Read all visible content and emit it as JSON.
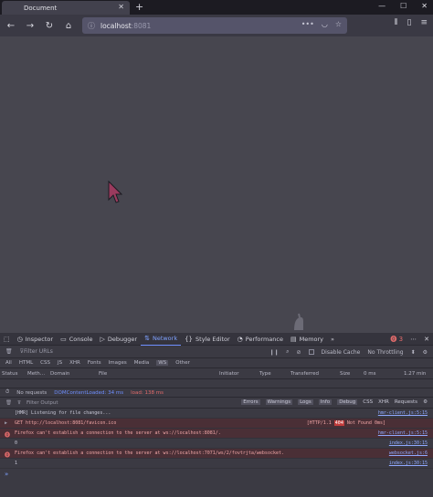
{
  "browser": {
    "tab_title": "Document",
    "new_tab_symbol": "+",
    "url_host": "localhost",
    "url_port": ":8081"
  },
  "devtools": {
    "tools": [
      "Inspector",
      "Console",
      "Debugger",
      "Network",
      "Style Editor",
      "Performance",
      "Memory"
    ],
    "active_tool": "Network",
    "error_count": "3",
    "filter_placeholder": "Filter URLs",
    "disable_cache_label": "Disable Cache",
    "throttling_label": "No Throttling",
    "type_filters": [
      "All",
      "HTML",
      "CSS",
      "JS",
      "XHR",
      "Fonts",
      "Images",
      "Media",
      "WS",
      "Other"
    ],
    "selected_type": "WS",
    "columns": [
      "Status",
      "Meth…",
      "Domain",
      "File",
      "Initiator",
      "Type",
      "Transferred",
      "Size",
      "0 ms",
      "1.27 min"
    ],
    "status": {
      "requests": "No requests",
      "dom_loaded": "DOMContentLoaded: 34 ms",
      "load": "load: 138 ms"
    },
    "console": {
      "filter_placeholder": "Filter Output",
      "levels": [
        "Errors",
        "Warnings",
        "Logs",
        "Info",
        "Debug"
      ],
      "extra_filters": [
        "CSS",
        "XHR",
        "Requests"
      ],
      "messages": [
        {
          "type": "log",
          "text": "[HMR] Listening for file changes...",
          "source": "hmr-client.js:5:15"
        },
        {
          "type": "error",
          "text": "GET http://localhost:8081/favicon.ico",
          "badge_proto": "[HTTP/1.1",
          "badge_code": "404",
          "badge_text": "Not Found 0ms]",
          "source": ""
        },
        {
          "type": "error",
          "text": "Firefox can't establish a connection to the server at ws://localhost:8081/.",
          "source": "hmr-client.js:5:15"
        },
        {
          "type": "log",
          "text": "0",
          "source": "index.js:30:15"
        },
        {
          "type": "error",
          "text": "Firefox can't establish a connection to the server at ws://localhost:7071/ws/2/fovtrjta/websocket.",
          "source": "websocket.js:6"
        },
        {
          "type": "log",
          "text": "1",
          "source": "index.js:30:15"
        }
      ],
      "prompt": "»"
    }
  }
}
